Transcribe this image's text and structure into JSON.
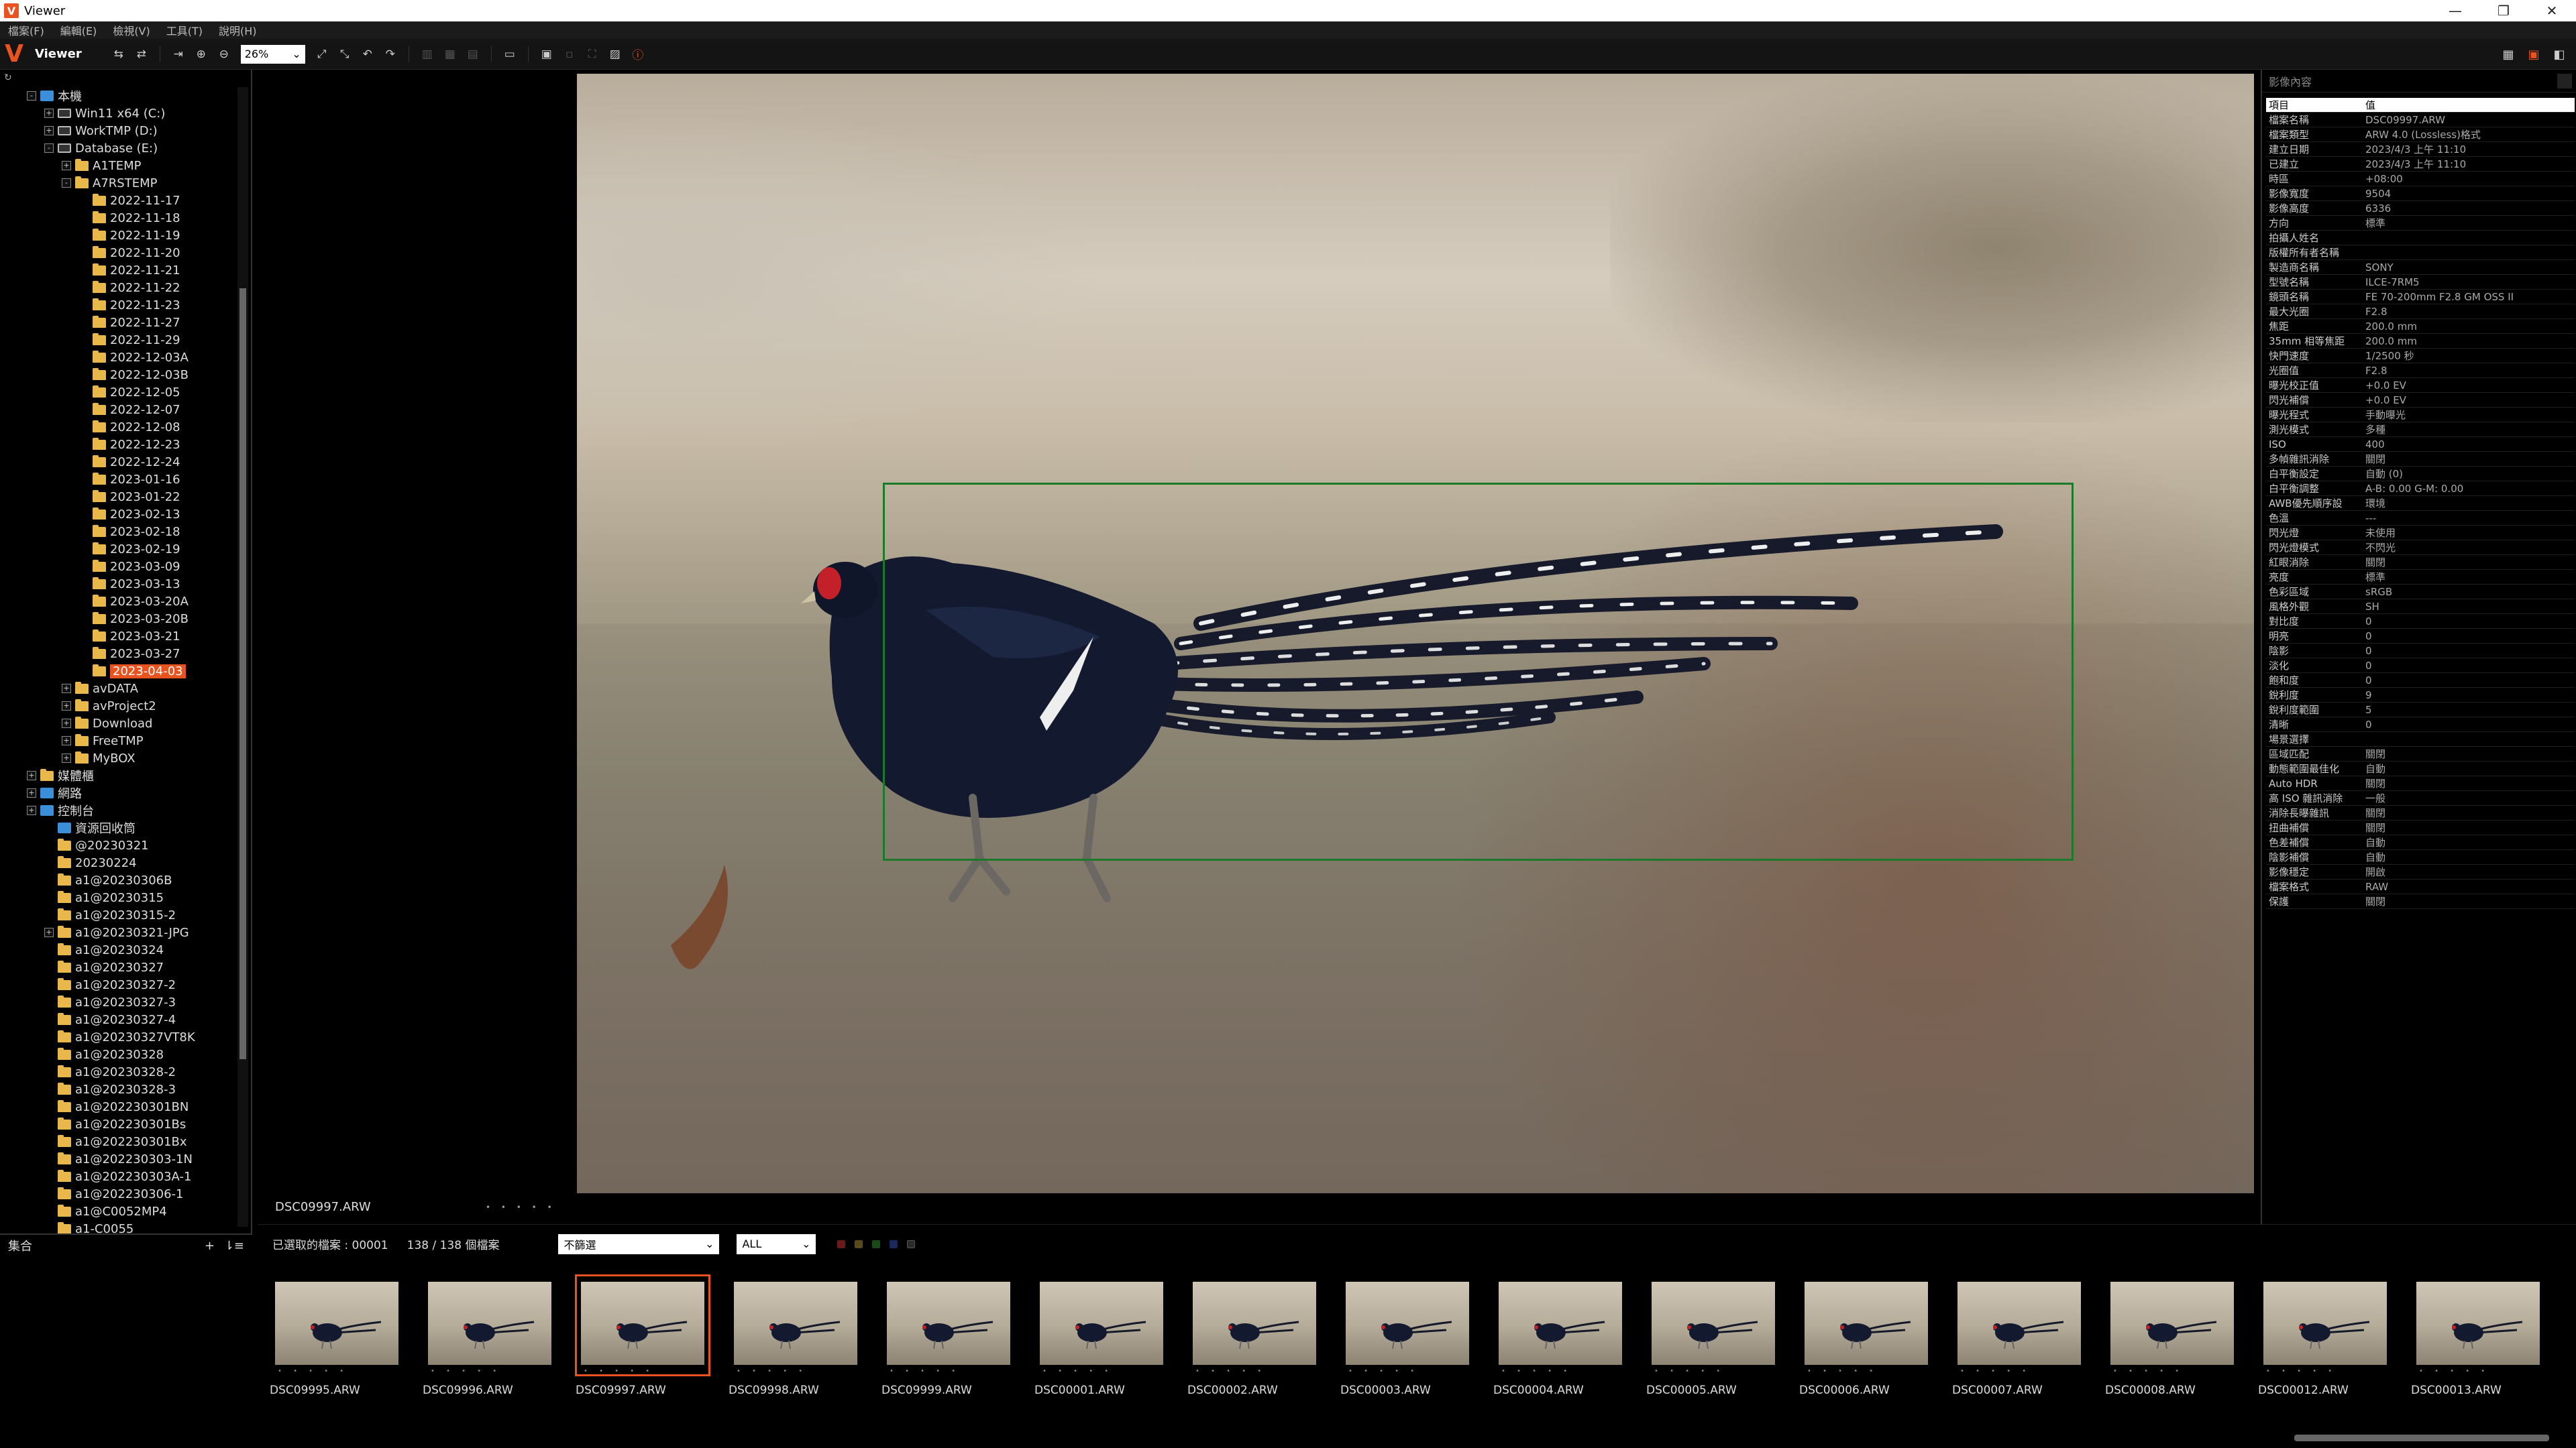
{
  "titlebar": {
    "title": "Viewer",
    "app_icon": "V",
    "minimize": "—",
    "restore": "❐",
    "close": "✕"
  },
  "menu": [
    "檔案(F)",
    "編輯(E)",
    "檢視(V)",
    "工具(T)",
    "說明(H)"
  ],
  "toolbar": {
    "logo": "V",
    "mode_label": "Viewer",
    "zoom_value": "26%"
  },
  "tree": {
    "items": [
      {
        "label": "本機",
        "level": 0,
        "icon": "pc",
        "exp": "-"
      },
      {
        "label": "Win11 x64 (C:)",
        "level": 1,
        "icon": "drive",
        "exp": "+"
      },
      {
        "label": "WorkTMP (D:)",
        "level": 1,
        "icon": "drive",
        "exp": "+"
      },
      {
        "label": "Database (E:)",
        "level": 1,
        "icon": "drive",
        "exp": "-"
      },
      {
        "label": "A1TEMP",
        "level": 2,
        "icon": "folder",
        "exp": "+"
      },
      {
        "label": "A7RSTEMP",
        "level": 2,
        "icon": "folder",
        "exp": "-"
      },
      {
        "label": "2022-11-17",
        "level": 3,
        "icon": "folder",
        "exp": ""
      },
      {
        "label": "2022-11-18",
        "level": 3,
        "icon": "folder",
        "exp": ""
      },
      {
        "label": "2022-11-19",
        "level": 3,
        "icon": "folder",
        "exp": ""
      },
      {
        "label": "2022-11-20",
        "level": 3,
        "icon": "folder",
        "exp": ""
      },
      {
        "label": "2022-11-21",
        "level": 3,
        "icon": "folder",
        "exp": ""
      },
      {
        "label": "2022-11-22",
        "level": 3,
        "icon": "folder",
        "exp": ""
      },
      {
        "label": "2022-11-23",
        "level": 3,
        "icon": "folder",
        "exp": ""
      },
      {
        "label": "2022-11-27",
        "level": 3,
        "icon": "folder",
        "exp": ""
      },
      {
        "label": "2022-11-29",
        "level": 3,
        "icon": "folder",
        "exp": ""
      },
      {
        "label": "2022-12-03A",
        "level": 3,
        "icon": "folder",
        "exp": ""
      },
      {
        "label": "2022-12-03B",
        "level": 3,
        "icon": "folder",
        "exp": ""
      },
      {
        "label": "2022-12-05",
        "level": 3,
        "icon": "folder",
        "exp": ""
      },
      {
        "label": "2022-12-07",
        "level": 3,
        "icon": "folder",
        "exp": ""
      },
      {
        "label": "2022-12-08",
        "level": 3,
        "icon": "folder",
        "exp": ""
      },
      {
        "label": "2022-12-23",
        "level": 3,
        "icon": "folder",
        "exp": ""
      },
      {
        "label": "2022-12-24",
        "level": 3,
        "icon": "folder",
        "exp": ""
      },
      {
        "label": "2023-01-16",
        "level": 3,
        "icon": "folder",
        "exp": ""
      },
      {
        "label": "2023-01-22",
        "level": 3,
        "icon": "folder",
        "exp": ""
      },
      {
        "label": "2023-02-13",
        "level": 3,
        "icon": "folder",
        "exp": ""
      },
      {
        "label": "2023-02-18",
        "level": 3,
        "icon": "folder",
        "exp": ""
      },
      {
        "label": "2023-02-19",
        "level": 3,
        "icon": "folder",
        "exp": ""
      },
      {
        "label": "2023-03-09",
        "level": 3,
        "icon": "folder",
        "exp": ""
      },
      {
        "label": "2023-03-13",
        "level": 3,
        "icon": "folder",
        "exp": ""
      },
      {
        "label": "2023-03-20A",
        "level": 3,
        "icon": "folder",
        "exp": ""
      },
      {
        "label": "2023-03-20B",
        "level": 3,
        "icon": "folder",
        "exp": ""
      },
      {
        "label": "2023-03-21",
        "level": 3,
        "icon": "folder",
        "exp": ""
      },
      {
        "label": "2023-03-27",
        "level": 3,
        "icon": "folder",
        "exp": ""
      },
      {
        "label": "2023-04-03",
        "level": 3,
        "icon": "folder",
        "exp": "",
        "selected": true
      },
      {
        "label": "avDATA",
        "level": 2,
        "icon": "folder",
        "exp": "+"
      },
      {
        "label": "avProject2",
        "level": 2,
        "icon": "folder",
        "exp": "+"
      },
      {
        "label": "Download",
        "level": 2,
        "icon": "folder",
        "exp": "+"
      },
      {
        "label": "FreeTMP",
        "level": 2,
        "icon": "folder",
        "exp": "+"
      },
      {
        "label": "MyBOX",
        "level": 2,
        "icon": "folder",
        "exp": "+"
      },
      {
        "label": "媒體櫃",
        "level": 0,
        "icon": "folder",
        "exp": "+"
      },
      {
        "label": "網路",
        "level": 0,
        "icon": "pc",
        "exp": "+"
      },
      {
        "label": "控制台",
        "level": 0,
        "icon": "pc",
        "exp": "+"
      },
      {
        "label": "資源回收筒",
        "level": 1,
        "icon": "pc",
        "exp": ""
      },
      {
        "label": "@20230321",
        "level": 1,
        "icon": "folder",
        "exp": ""
      },
      {
        "label": "20230224",
        "level": 1,
        "icon": "folder",
        "exp": ""
      },
      {
        "label": "a1@20230306B",
        "level": 1,
        "icon": "folder",
        "exp": ""
      },
      {
        "label": "a1@20230315",
        "level": 1,
        "icon": "folder",
        "exp": ""
      },
      {
        "label": "a1@20230315-2",
        "level": 1,
        "icon": "folder",
        "exp": ""
      },
      {
        "label": "a1@20230321-JPG",
        "level": 1,
        "icon": "folder",
        "exp": "+"
      },
      {
        "label": "a1@20230324",
        "level": 1,
        "icon": "folder",
        "exp": ""
      },
      {
        "label": "a1@20230327",
        "level": 1,
        "icon": "folder",
        "exp": ""
      },
      {
        "label": "a1@20230327-2",
        "level": 1,
        "icon": "folder",
        "exp": ""
      },
      {
        "label": "a1@20230327-3",
        "level": 1,
        "icon": "folder",
        "exp": ""
      },
      {
        "label": "a1@20230327-4",
        "level": 1,
        "icon": "folder",
        "exp": ""
      },
      {
        "label": "a1@20230327VT8K",
        "level": 1,
        "icon": "folder",
        "exp": ""
      },
      {
        "label": "a1@20230328",
        "level": 1,
        "icon": "folder",
        "exp": ""
      },
      {
        "label": "a1@20230328-2",
        "level": 1,
        "icon": "folder",
        "exp": ""
      },
      {
        "label": "a1@20230328-3",
        "level": 1,
        "icon": "folder",
        "exp": ""
      },
      {
        "label": "a1@202230301BN",
        "level": 1,
        "icon": "folder",
        "exp": ""
      },
      {
        "label": "a1@202230301Bs",
        "level": 1,
        "icon": "folder",
        "exp": ""
      },
      {
        "label": "a1@202230301Bx",
        "level": 1,
        "icon": "folder",
        "exp": ""
      },
      {
        "label": "a1@202230303-1N",
        "level": 1,
        "icon": "folder",
        "exp": ""
      },
      {
        "label": "a1@202230303A-1",
        "level": 1,
        "icon": "folder",
        "exp": ""
      },
      {
        "label": "a1@202230306-1",
        "level": 1,
        "icon": "folder",
        "exp": ""
      },
      {
        "label": "a1@C0052MP4",
        "level": 1,
        "icon": "folder",
        "exp": ""
      },
      {
        "label": "a1-C0055",
        "level": 1,
        "icon": "folder",
        "exp": ""
      }
    ]
  },
  "collection": {
    "title": "集合",
    "add": "+",
    "sort": "⇂≡"
  },
  "viewer": {
    "filename": "DSC09997.ARW",
    "rating_dots": "• • • • •"
  },
  "info": {
    "title": "影像內容",
    "col_key": "項目",
    "col_val": "值",
    "rows": [
      [
        "檔案名稱",
        "DSC09997.ARW"
      ],
      [
        "檔案類型",
        "ARW 4.0 (Lossless)格式"
      ],
      [
        "建立日期",
        "2023/4/3 上午 11:10"
      ],
      [
        "已建立",
        "2023/4/3 上午 11:10"
      ],
      [
        "時區",
        "+08:00"
      ],
      [
        "影像寬度",
        "9504"
      ],
      [
        "影像高度",
        "6336"
      ],
      [
        "方向",
        "標準"
      ],
      [
        "拍攝人姓名",
        ""
      ],
      [
        "版權所有者名稱",
        ""
      ],
      [
        "製造商名稱",
        "SONY"
      ],
      [
        "型號名稱",
        "ILCE-7RM5"
      ],
      [
        "鏡頭名稱",
        "FE 70-200mm F2.8 GM OSS II"
      ],
      [
        "最大光圈",
        "F2.8"
      ],
      [
        "焦距",
        "200.0 mm"
      ],
      [
        "35mm 相等焦距",
        "200.0 mm"
      ],
      [
        "快門速度",
        "1/2500 秒"
      ],
      [
        "光圈值",
        "F2.8"
      ],
      [
        "曝光校正值",
        "+0.0 EV"
      ],
      [
        "閃光補償",
        "+0.0 EV"
      ],
      [
        "曝光程式",
        "手動曝光"
      ],
      [
        "測光模式",
        "多種"
      ],
      [
        "ISO",
        "400"
      ],
      [
        "多幀雜訊消除",
        "關閉"
      ],
      [
        "白平衡設定",
        "自動 (0)"
      ],
      [
        "白平衡調整",
        "A-B: 0.00 G-M: 0.00"
      ],
      [
        "AWB優先順序設",
        "環境"
      ],
      [
        "色溫",
        "---"
      ],
      [
        "閃光燈",
        "未使用"
      ],
      [
        "閃光燈模式",
        "不閃光"
      ],
      [
        "紅眼消除",
        "關閉"
      ],
      [
        "亮度",
        "標準"
      ],
      [
        "色彩區域",
        "sRGB"
      ],
      [
        "風格外觀",
        "SH"
      ],
      [
        "對比度",
        "0"
      ],
      [
        "明亮",
        "0"
      ],
      [
        "陰影",
        "0"
      ],
      [
        "淡化",
        "0"
      ],
      [
        "飽和度",
        "0"
      ],
      [
        "銳利度",
        "9"
      ],
      [
        "銳利度範圍",
        "5"
      ],
      [
        "清晰",
        "0"
      ],
      [
        "場景選擇",
        ""
      ],
      [
        "區域匹配",
        "關閉"
      ],
      [
        "動態範圍最佳化",
        "自動"
      ],
      [
        "Auto HDR",
        "關閉"
      ],
      [
        "高 ISO 雜訊消除",
        "一般"
      ],
      [
        "消除長曝雜訊",
        "關閉"
      ],
      [
        "扭曲補償",
        "關閉"
      ],
      [
        "色差補償",
        "自動"
      ],
      [
        "陰影補償",
        "自動"
      ],
      [
        "影像穩定",
        "開啟"
      ],
      [
        "檔案格式",
        "RAW"
      ],
      [
        "保護",
        "關閉"
      ]
    ]
  },
  "filter": {
    "selected": "已選取的檔案 : 00001",
    "count": "138 / 138 個檔案",
    "rating_filter": "不篩選",
    "label_filter": "ALL"
  },
  "thumbs": [
    "DSC09995.ARW",
    "DSC09996.ARW",
    "DSC09997.ARW",
    "DSC09998.ARW",
    "DSC09999.ARW",
    "DSC00001.ARW",
    "DSC00002.ARW",
    "DSC00003.ARW",
    "DSC00004.ARW",
    "DSC00005.ARW",
    "DSC00006.ARW",
    "DSC00007.ARW",
    "DSC00008.ARW",
    "DSC00012.ARW",
    "DSC00013.ARW"
  ],
  "colors": {
    "accent": "#e8531f",
    "focus_box": "#1b7a2a",
    "folder": "#e8b84a"
  }
}
